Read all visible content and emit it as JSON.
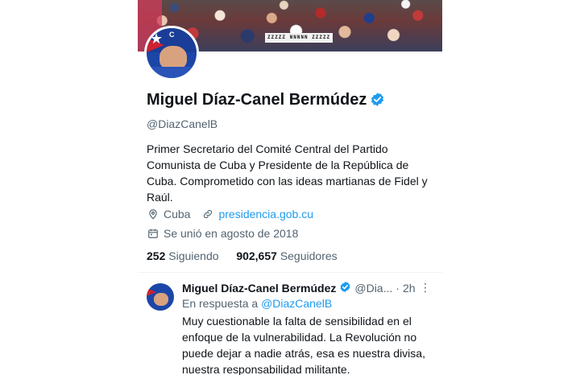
{
  "banner": {
    "sign_text": "ZZZZZ NNNNN ZZZZZ"
  },
  "profile": {
    "name": "Miguel Díaz-Canel Bermúdez",
    "handle": "@DiazCanelB",
    "bio": "Primer Secretario del Comité Central del Partido Comunista de Cuba y Presidente de la República de Cuba. Comprometido con las ideas martianas de Fidel y Raúl.",
    "location": "Cuba",
    "website": "presidencia.gob.cu",
    "joined": "Se unió en agosto de 2018",
    "following_count": "252",
    "following_label": "Siguiendo",
    "followers_count": "902,657",
    "followers_label": "Seguidores"
  },
  "tweet": {
    "author_name": "Miguel Díaz-Canel Bermúdez",
    "author_handle": "@Dia...",
    "separator": "·",
    "time": "2h",
    "more": "⋮",
    "reply_prefix": "En respuesta a",
    "reply_to": "@DiazCanelB",
    "text": "Muy cuestionable la falta de sensibilidad en el enfoque de la vulnerabilidad. La Revolución no puede dejar a nadie atrás, esa es nuestra divisa, nuestra responsabilidad militante."
  },
  "colors": {
    "accent": "#1d9bf0",
    "text": "#0f1419",
    "muted": "#536471"
  },
  "icons": {
    "verified": "verified-badge-icon",
    "location": "map-pin-icon",
    "link": "link-icon",
    "calendar": "calendar-icon",
    "more": "more-icon"
  }
}
